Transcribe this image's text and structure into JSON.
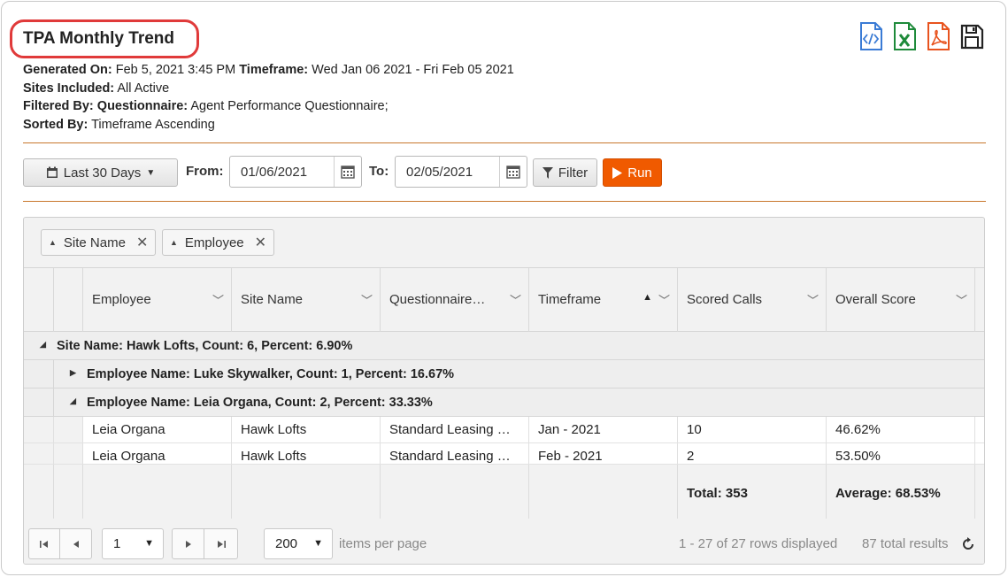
{
  "header": {
    "title": "TPA Monthly Trend",
    "generated_on_label": "Generated On:",
    "generated_on_value": "Feb 5, 2021 3:45 PM",
    "timeframe_label": "Timeframe:",
    "timeframe_value": "Wed Jan 06 2021 - Fri Feb 05 2021",
    "sites_label": "Sites Included:",
    "sites_value": "All Active",
    "filtered_label": "Filtered By:",
    "filtered_key": "Questionnaire:",
    "filtered_value": "Agent Performance Questionnaire;",
    "sorted_label": "Sorted By:",
    "sorted_value": "Timeframe Ascending",
    "export_icons": [
      "code-export-icon",
      "excel-export-icon",
      "pdf-export-icon",
      "save-icon"
    ]
  },
  "toolbar": {
    "range_label": "Last 30 Days",
    "from_label": "From:",
    "from_value": "01/06/2021",
    "to_label": "To:",
    "to_value": "02/05/2021",
    "filter_label": "Filter",
    "run_label": "Run"
  },
  "grid": {
    "group_chips": [
      "Site Name",
      "Employee"
    ],
    "columns": [
      "Employee",
      "Site Name",
      "Questionnaire…",
      "Timeframe",
      "Scored Calls",
      "Overall Score"
    ],
    "groups": [
      "Site Name: Hawk Lofts, Count: 6, Percent: 6.90%",
      "Employee Name: Luke Skywalker, Count: 1, Percent: 16.67%",
      "Employee Name: Leia Organa, Count: 2, Percent: 33.33%"
    ],
    "rows": [
      [
        "Leia Organa",
        "Hawk Lofts",
        "Standard Leasing …",
        "Jan - 2021",
        "10",
        "46.62%"
      ],
      [
        "Leia Organa",
        "Hawk Lofts",
        "Standard Leasing …",
        "Feb - 2021",
        "2",
        "53.50%"
      ]
    ],
    "footer": {
      "total": "Total: 353",
      "average": "Average: 68.53%"
    }
  },
  "pager": {
    "page": "1",
    "page_size": "200",
    "items_per_page": "items per page",
    "rows_displayed": "1 - 27 of 27 rows displayed",
    "total_results": "87 total results"
  },
  "colors": {
    "accent": "#f05a00",
    "title_outline": "#e03a3a",
    "rule": "#c8772c"
  }
}
